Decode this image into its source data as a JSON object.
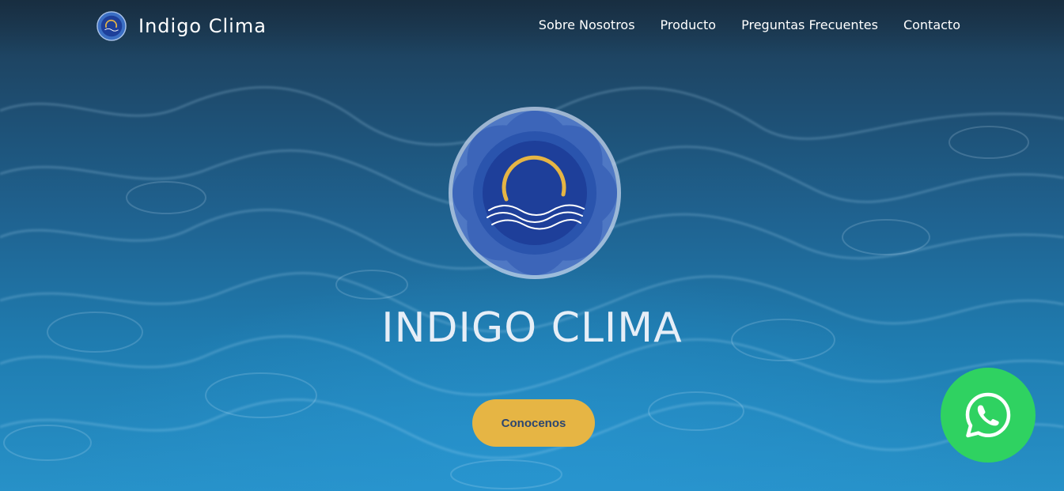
{
  "header": {
    "brand_name": "Indigo Clima",
    "logo_icon": "indigo-clima-logo-icon",
    "nav": [
      {
        "label": "Sobre Nosotros"
      },
      {
        "label": "Producto"
      },
      {
        "label": "Preguntas Frecuentes"
      },
      {
        "label": "Contacto"
      }
    ]
  },
  "hero": {
    "title": "INDIGO CLIMA",
    "cta_label": "Conocenos",
    "logo_icon": "indigo-clima-emblem-icon"
  },
  "floating": {
    "whatsapp_icon": "whatsapp-icon"
  },
  "colors": {
    "cta_background": "#e6b544",
    "cta_text": "#2c4670",
    "whatsapp_green": "#2fd261",
    "emblem_blue": "#1e3f9a",
    "emblem_gold": "#e6b544"
  }
}
